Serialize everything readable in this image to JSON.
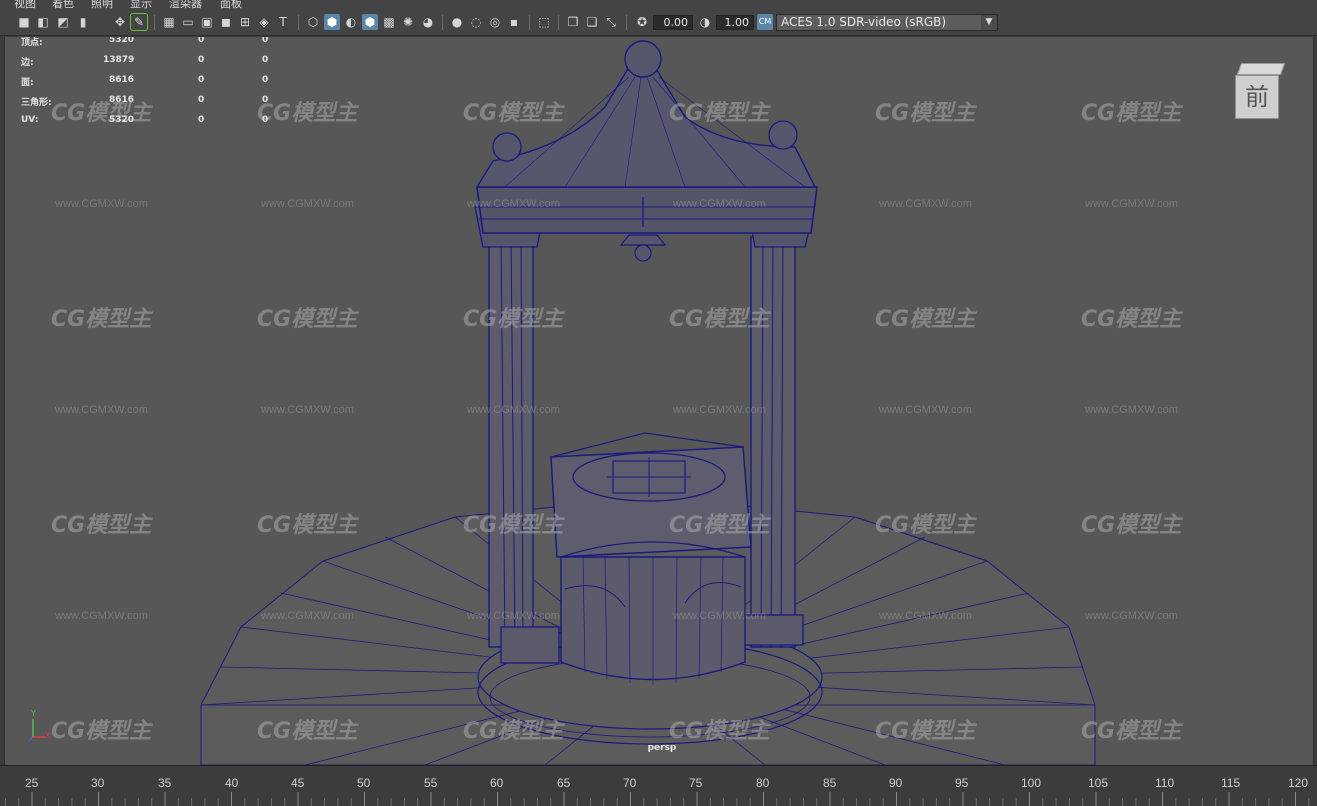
{
  "menubar": {
    "items": [
      "视图",
      "着色",
      "照明",
      "显示",
      "渲染器",
      "面板"
    ]
  },
  "toolbar": {
    "exposure_value": "0.00",
    "gamma_value": "1.00",
    "color_space": "ACES 1.0 SDR-video (sRGB)",
    "icons": [
      "camera-select-icon",
      "camera-attributes-icon",
      "bookmark-icon",
      "image-plane-icon",
      "two-d-pan-zoom-icon",
      "grease-pencil-icon",
      "grid-icon",
      "film-gate-icon",
      "resolution-gate-icon",
      "gate-mask-icon",
      "field-chart-icon",
      "safe-action-icon",
      "safe-title-icon",
      "wireframe-icon",
      "smooth-shade-icon",
      "default-material-icon",
      "wireframe-on-shaded-icon",
      "xray-icon",
      "all-lights-icon",
      "shadows-icon",
      "ambient-occlusion-icon",
      "motion-blur-icon",
      "multisample-aa-icon",
      "depth-of-field-icon",
      "isolate-select-icon",
      "xray-joints-icon",
      "xray-active-icon",
      "frame-all-icon",
      "exposure-icon",
      "gamma-icon",
      "color-management-icon"
    ]
  },
  "hud": {
    "rows": [
      {
        "label": "顶点:",
        "a": "5320",
        "b": "0",
        "c": "0"
      },
      {
        "label": "边:",
        "a": "13879",
        "b": "0",
        "c": "0"
      },
      {
        "label": "面:",
        "a": "8616",
        "b": "0",
        "c": "0"
      },
      {
        "label": "三角形:",
        "a": "8616",
        "b": "0",
        "c": "0"
      },
      {
        "label": "UV:",
        "a": "5320",
        "b": "0",
        "c": "0"
      }
    ]
  },
  "viewport": {
    "camera_label": "persp",
    "viewcube_face": "前",
    "axis": {
      "y": "Y",
      "x": "X",
      "z": "Z"
    },
    "wireframe_color": "#1a1a80",
    "background_color": "#575757"
  },
  "watermark": {
    "logo_text": "CG模型主",
    "url_text": "www.CGMXW.com"
  },
  "timeline": {
    "ticks": [
      "25",
      "30",
      "35",
      "40",
      "45",
      "50",
      "55",
      "60",
      "65",
      "70",
      "75",
      "80",
      "85",
      "90",
      "95",
      "100",
      "105",
      "110",
      "115",
      "120"
    ]
  },
  "colors": {
    "active_button": "#5a87a8",
    "panel": "#444444"
  }
}
